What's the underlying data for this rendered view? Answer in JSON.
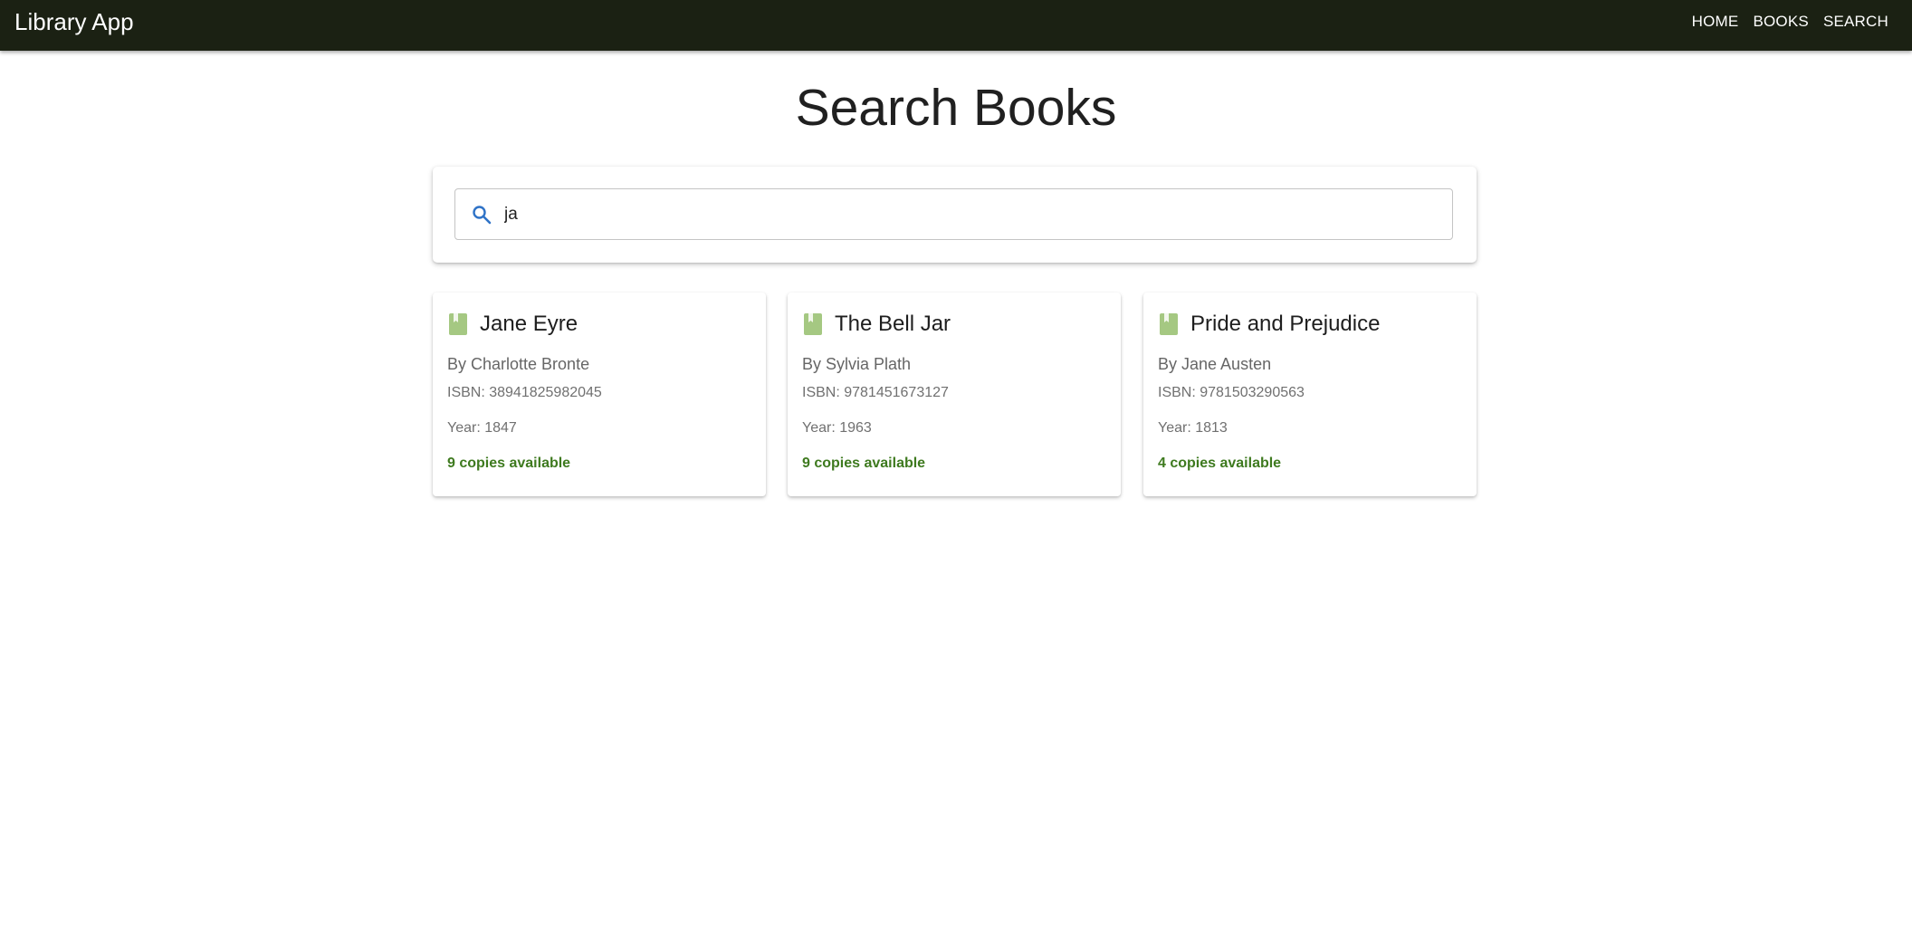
{
  "app": {
    "title": "Library App"
  },
  "nav": {
    "items": [
      {
        "label": "HOME"
      },
      {
        "label": "BOOKS"
      },
      {
        "label": "SEARCH"
      }
    ]
  },
  "page": {
    "title": "Search Books"
  },
  "search": {
    "value": "ja",
    "icon": "search-icon"
  },
  "results": [
    {
      "title": "Jane Eyre",
      "author": "By Charlotte Bronte",
      "isbn": "ISBN: 38941825982045",
      "year": "Year: 1847",
      "copies": "9 copies available",
      "icon": "book-icon"
    },
    {
      "title": "The Bell Jar",
      "author": "By Sylvia Plath",
      "isbn": "ISBN: 9781451673127",
      "year": "Year: 1963",
      "copies": "9 copies available",
      "icon": "book-icon"
    },
    {
      "title": "Pride and Prejudice",
      "author": "By Jane Austen",
      "isbn": "ISBN: 9781503290563",
      "year": "Year: 1813",
      "copies": "4 copies available",
      "icon": "book-icon"
    }
  ],
  "colors": {
    "appbar": "#1b2113",
    "available": "#3e7a1f",
    "book_icon": "#a5c882",
    "search_icon": "#2f73c7"
  }
}
